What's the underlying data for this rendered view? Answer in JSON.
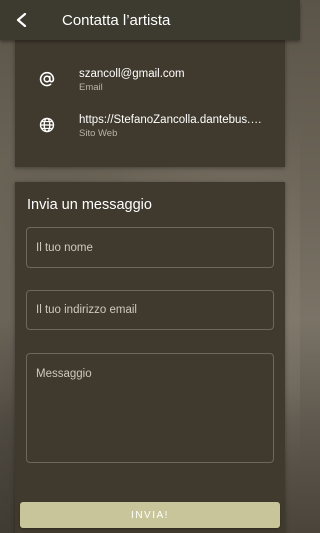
{
  "header": {
    "title": "Contatta l’artista",
    "back_icon": "arrow-left-icon"
  },
  "contacts": [
    {
      "icon": "at-sign-icon",
      "value": "szancoll@gmail.com",
      "label": "Email"
    },
    {
      "icon": "globe-icon",
      "value": "https://StefanoZancolla.dantebus.com",
      "label": "Sito Web"
    }
  ],
  "message_form": {
    "title": "Invia un messaggio",
    "name_placeholder": "Il tuo nome",
    "email_placeholder": "Il tuo indirizzo email",
    "message_placeholder": "Messaggio",
    "submit_label": "INVIA!"
  },
  "colors": {
    "header_bg": "#3d3a2f",
    "card_bg": "#403a2e",
    "button_bg": "#c8c59b"
  }
}
